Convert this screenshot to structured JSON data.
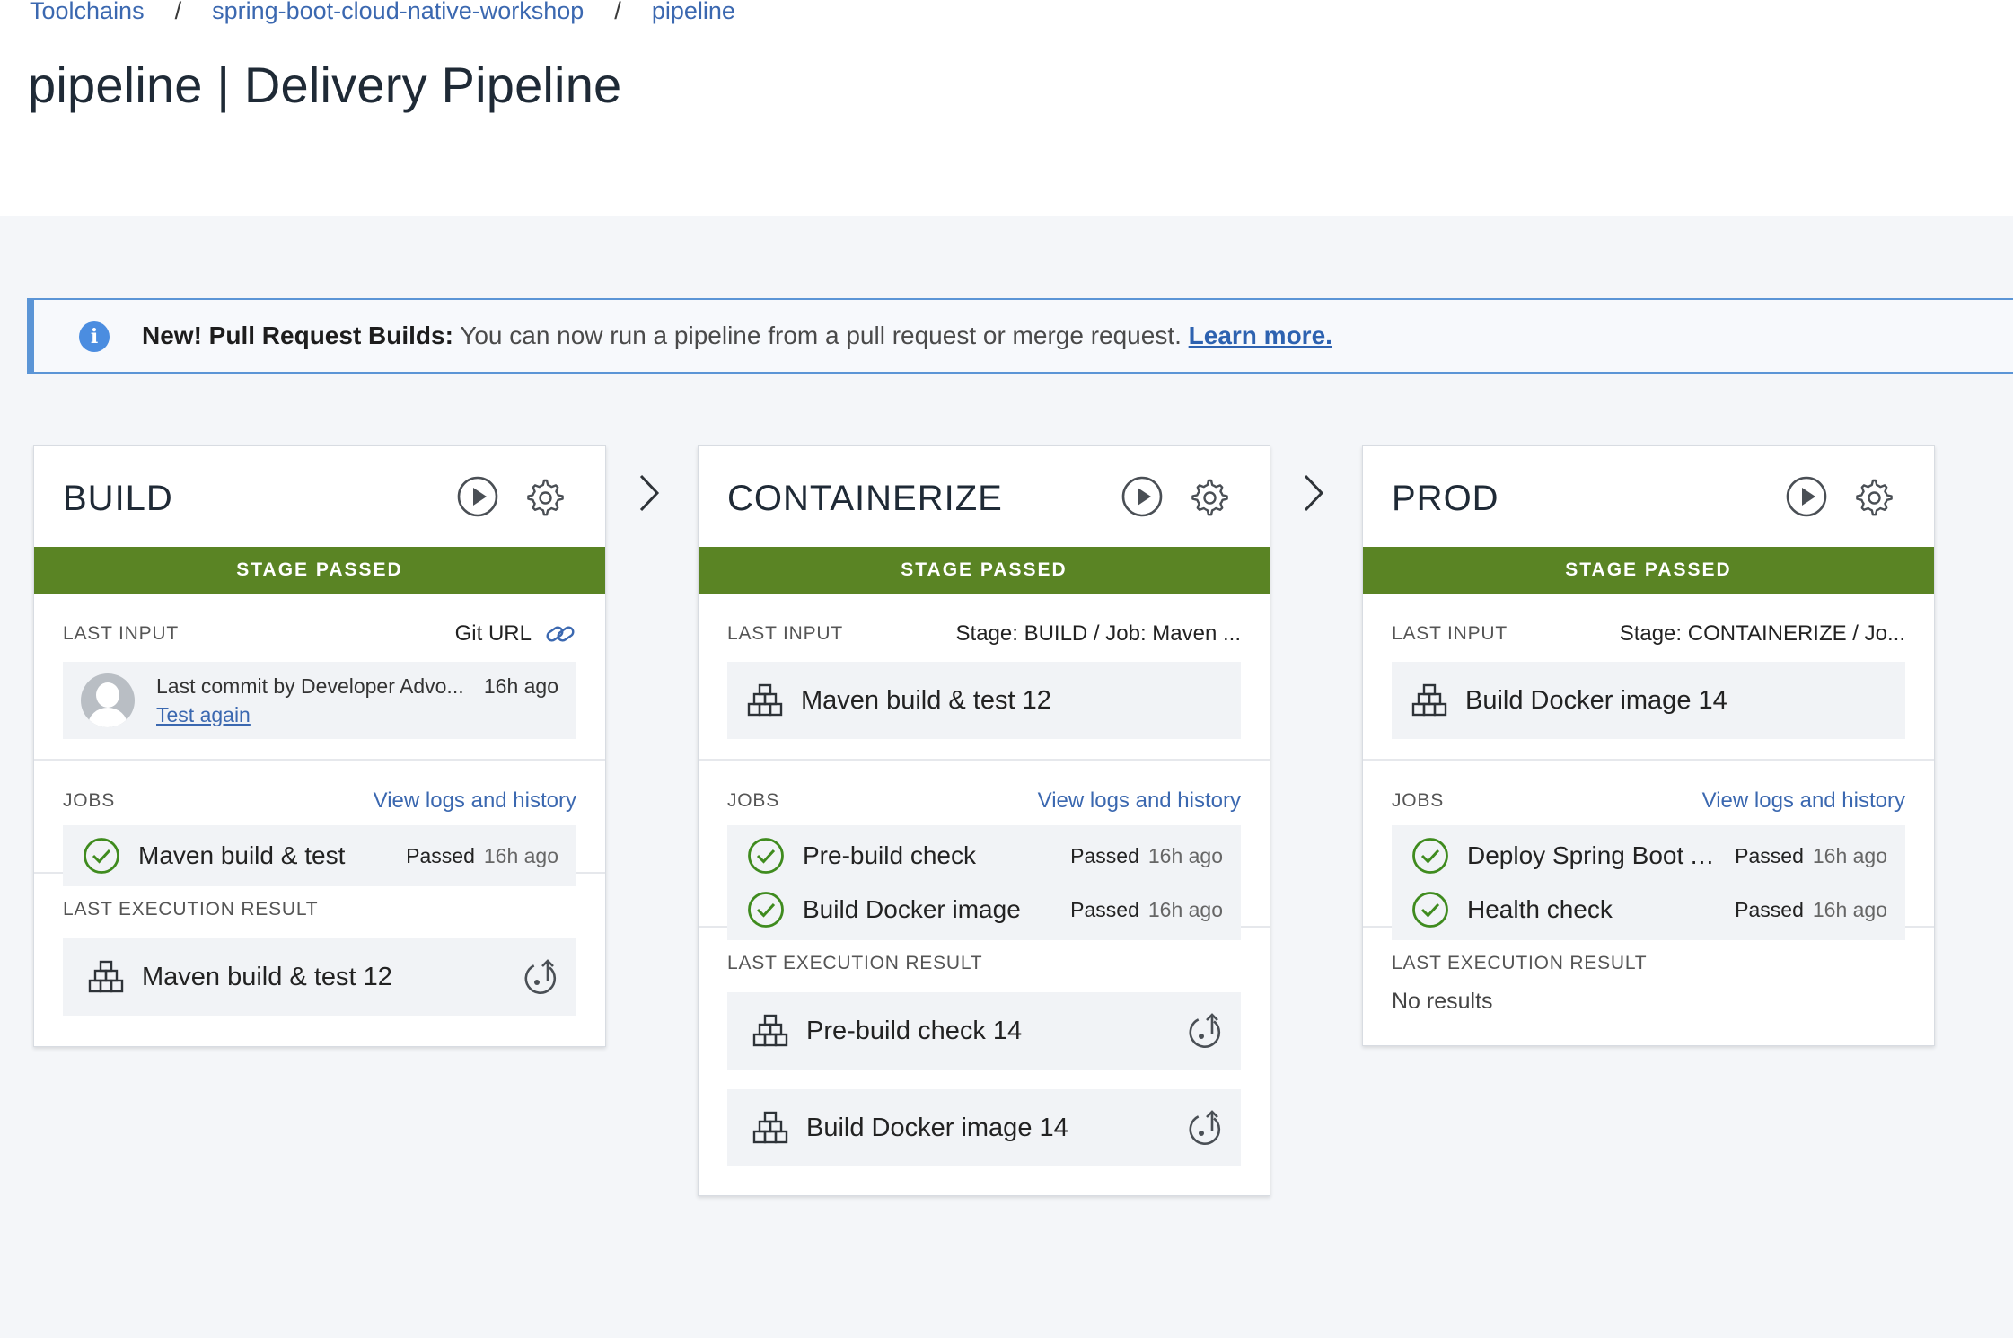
{
  "breadcrumb": {
    "items": [
      "Toolchains",
      "spring-boot-cloud-native-workshop",
      "pipeline"
    ],
    "separator": "/"
  },
  "page_title": "pipeline | Delivery Pipeline",
  "banner": {
    "bold": "New! Pull Request Builds:",
    "text": " You can now run a pipeline from a pull request or merge request. ",
    "link": "Learn more."
  },
  "colors": {
    "stage_passed": "#5a8424",
    "link": "#3b68b0",
    "banner_border": "#5b95d6",
    "check": "#3f8b1e"
  },
  "stages": {
    "build": {
      "title": "BUILD",
      "status": "STAGE PASSED",
      "last_input_label": "LAST INPUT",
      "input_source": "Git URL",
      "commit_text": "Last commit by Developer Advo...",
      "commit_time": "16h ago",
      "test_again": "Test again",
      "jobs_label": "JOBS",
      "view_logs": "View logs and history",
      "jobs": [
        {
          "name": "Maven build & test",
          "status": "Passed",
          "time": "16h ago"
        }
      ],
      "result_label": "LAST EXECUTION RESULT",
      "results": [
        "Maven build & test 12"
      ]
    },
    "containerize": {
      "title": "CONTAINERIZE",
      "status": "STAGE PASSED",
      "last_input_label": "LAST INPUT",
      "input_source": "Stage: BUILD  /  Job: Maven ...",
      "input_item": "Maven build & test 12",
      "jobs_label": "JOBS",
      "view_logs": "View logs and history",
      "jobs": [
        {
          "name": "Pre-build check",
          "status": "Passed",
          "time": "16h ago"
        },
        {
          "name": "Build Docker image",
          "status": "Passed",
          "time": "16h ago"
        }
      ],
      "result_label": "LAST EXECUTION RESULT",
      "results": [
        "Pre-build check 14",
        "Build Docker image 14"
      ]
    },
    "prod": {
      "title": "PROD",
      "status": "STAGE PASSED",
      "last_input_label": "LAST INPUT",
      "input_source": "Stage: CONTAINERIZE  /  Jo...",
      "input_item": "Build Docker image 14",
      "jobs_label": "JOBS",
      "view_logs": "View logs and history",
      "jobs": [
        {
          "name": "Deploy Spring Boot A...",
          "status": "Passed",
          "time": "16h ago"
        },
        {
          "name": "Health check",
          "status": "Passed",
          "time": "16h ago"
        }
      ],
      "result_label": "LAST EXECUTION RESULT",
      "no_results": "No results"
    }
  }
}
